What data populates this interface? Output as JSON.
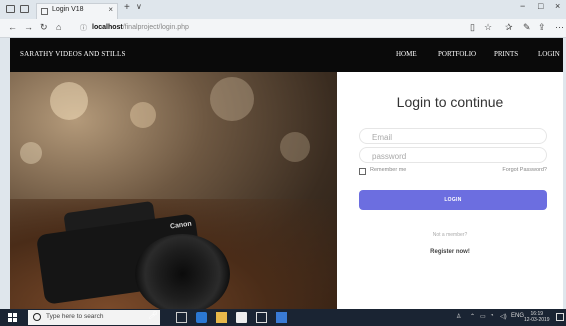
{
  "browser": {
    "tab_title": "Login V18",
    "tab_close": "×",
    "new_tab": "+",
    "tab_list": "∨",
    "url_host": "localhost",
    "url_path": "/finalproject/login.php",
    "window": {
      "minimize": "−",
      "maximize": "□",
      "close": "×"
    }
  },
  "site": {
    "brand": "SARATHY VIDEOS AND STILLS",
    "menu": [
      "HOME",
      "PORTFOLIO",
      "PRINTS",
      "LOGIN"
    ]
  },
  "photo": {
    "camera_brand": "Canon"
  },
  "login": {
    "title": "Login to continue",
    "email_placeholder": "Email",
    "password_placeholder": "password",
    "remember_label": "Remember me",
    "forgot_label": "Forgot Password?",
    "button_label": "LOGIN",
    "not_member": "Not a member?",
    "register_label": "Register now!"
  },
  "taskbar": {
    "search_placeholder": "Type here to search",
    "language": "ENG",
    "time": "16:19",
    "date": "12-03-2019"
  },
  "colors": {
    "accent": "#6c6ee0",
    "nav_bg": "#0a0a0a",
    "taskbar_bg": "#1a2433"
  }
}
